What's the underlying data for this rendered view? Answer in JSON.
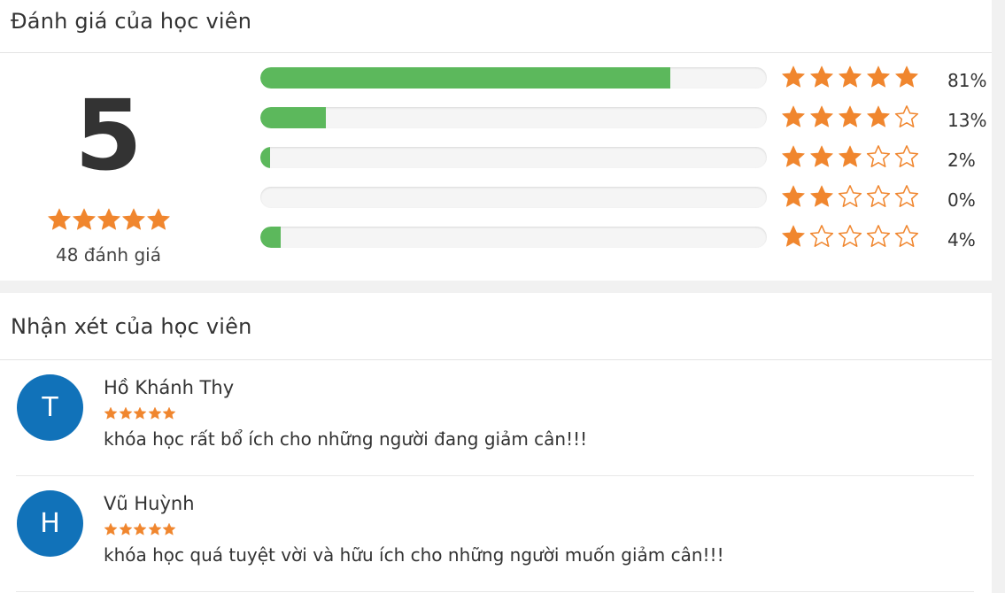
{
  "ratings": {
    "title": "Đánh giá của học viên",
    "average": "5",
    "average_stars": 5,
    "count_label": "48 đánh giá",
    "star_color": "#f0862e",
    "bar_color": "#5cb85c",
    "breakdown": [
      {
        "stars": 5,
        "percent": 81,
        "label": "81%"
      },
      {
        "stars": 4,
        "percent": 13,
        "label": "13%"
      },
      {
        "stars": 3,
        "percent": 2,
        "label": "2%"
      },
      {
        "stars": 2,
        "percent": 0,
        "label": "0%"
      },
      {
        "stars": 1,
        "percent": 4,
        "label": "4%"
      }
    ]
  },
  "reviews": {
    "title": "Nhận xét của học viên",
    "avatar_color": "#1172b9",
    "items": [
      {
        "initial": "T",
        "name": "Hồ Khánh Thy",
        "stars": 5,
        "text": "khóa học rất bổ ích cho những người đang giảm cân!!!"
      },
      {
        "initial": "H",
        "name": "Vũ Huỳnh",
        "stars": 5,
        "text": "khóa học quá tuyệt vời và hữu ích cho những người muốn giảm cân!!!"
      }
    ]
  }
}
